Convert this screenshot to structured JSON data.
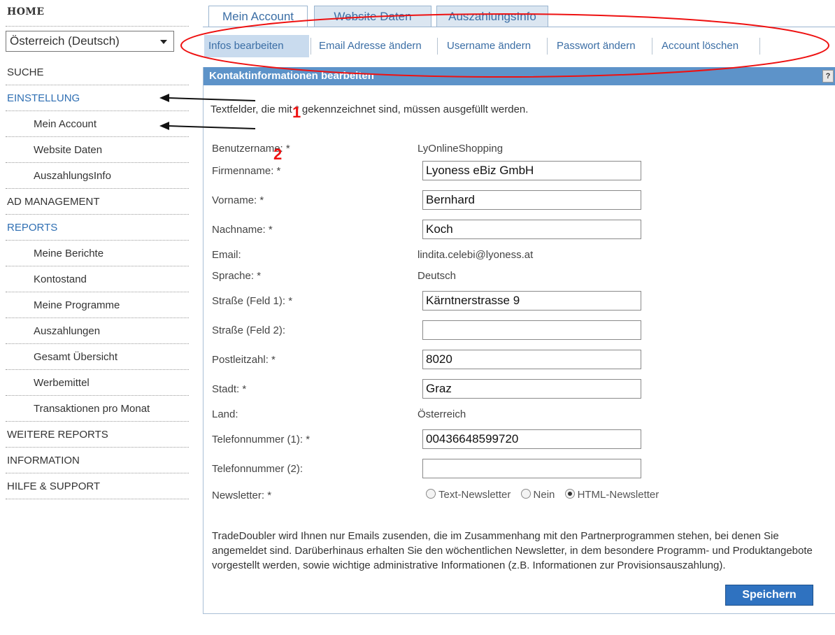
{
  "sidebar": {
    "home": "HOME",
    "country_select": "Österreich (Deutsch)",
    "items": [
      {
        "label": "SUCHE"
      },
      {
        "label": "EINSTELLUNG"
      },
      {
        "label": "Mein Account"
      },
      {
        "label": "Website Daten"
      },
      {
        "label": "AuszahlungsInfo"
      },
      {
        "label": "AD MANAGEMENT"
      },
      {
        "label": "REPORTS"
      },
      {
        "label": "Meine Berichte"
      },
      {
        "label": "Kontostand"
      },
      {
        "label": "Meine Programme"
      },
      {
        "label": "Auszahlungen"
      },
      {
        "label": "Gesamt Übersicht"
      },
      {
        "label": "Werbemittel"
      },
      {
        "label": "Transaktionen pro Monat"
      },
      {
        "label": "WEITERE REPORTS"
      },
      {
        "label": "INFORMATION"
      },
      {
        "label": "HILFE & SUPPORT"
      }
    ]
  },
  "tabs": [
    "Mein Account",
    "Website Daten",
    "AuszahlungsInfo"
  ],
  "subtabs": [
    "Infos bearbeiten",
    "Email Adresse ändern",
    "Username ändern",
    "Passwort ändern",
    "Account löschen"
  ],
  "panel": {
    "title": "Kontaktinformationen bearbeiten",
    "help": "?",
    "intro": "Textfelder, die mit * gekennzeichnet sind, müssen ausgefüllt werden.",
    "fields": {
      "benutzername": {
        "label": "Benutzername: *",
        "value": "LyOnlineShopping"
      },
      "firmenname": {
        "label": "Firmenname: *",
        "value": "Lyoness eBiz GmbH"
      },
      "vorname": {
        "label": "Vorname: *",
        "value": "Bernhard"
      },
      "nachname": {
        "label": "Nachname: *",
        "value": "Koch"
      },
      "email": {
        "label": "Email:",
        "value": "lindita.celebi@lyoness.at"
      },
      "sprache": {
        "label": "Sprache: *",
        "value": "Deutsch"
      },
      "strasse1": {
        "label": "Straße (Feld 1): *",
        "value": "Kärntnerstrasse 9"
      },
      "strasse2": {
        "label": "Straße (Feld 2):",
        "value": ""
      },
      "plz": {
        "label": "Postleitzahl: *",
        "value": "8020"
      },
      "stadt": {
        "label": "Stadt: *",
        "value": "Graz"
      },
      "land": {
        "label": "Land:",
        "value": "Österreich"
      },
      "telefon1": {
        "label": "Telefonnummer (1): *",
        "value": "00436648599720"
      },
      "telefon2": {
        "label": "Telefonnummer (2):",
        "value": ""
      }
    },
    "newsletter": {
      "label": "Newsletter: *",
      "options": [
        "Text-Newsletter",
        "Nein",
        "HTML-Newsletter"
      ],
      "selected": "HTML-Newsletter"
    },
    "disclaimer": "TradeDoubler wird Ihnen nur Emails zusenden, die im Zusammenhang mit den Partnerprogrammen stehen, bei denen Sie angemeldet sind. Darüberhinaus erhalten Sie den wöchentlichen Newsletter, in dem besondere Programm- und Produktangebote vorgestellt werden, sowie wichtige administrative Informationen (z.B. Informationen zur Provisionsauszahlung).",
    "save": "Speichern"
  },
  "annotations": {
    "num1": "1",
    "num2": "2"
  },
  "colors": {
    "accent": "#3b6ea5",
    "header": "#5d93c9",
    "annotation": "#ee1111"
  }
}
